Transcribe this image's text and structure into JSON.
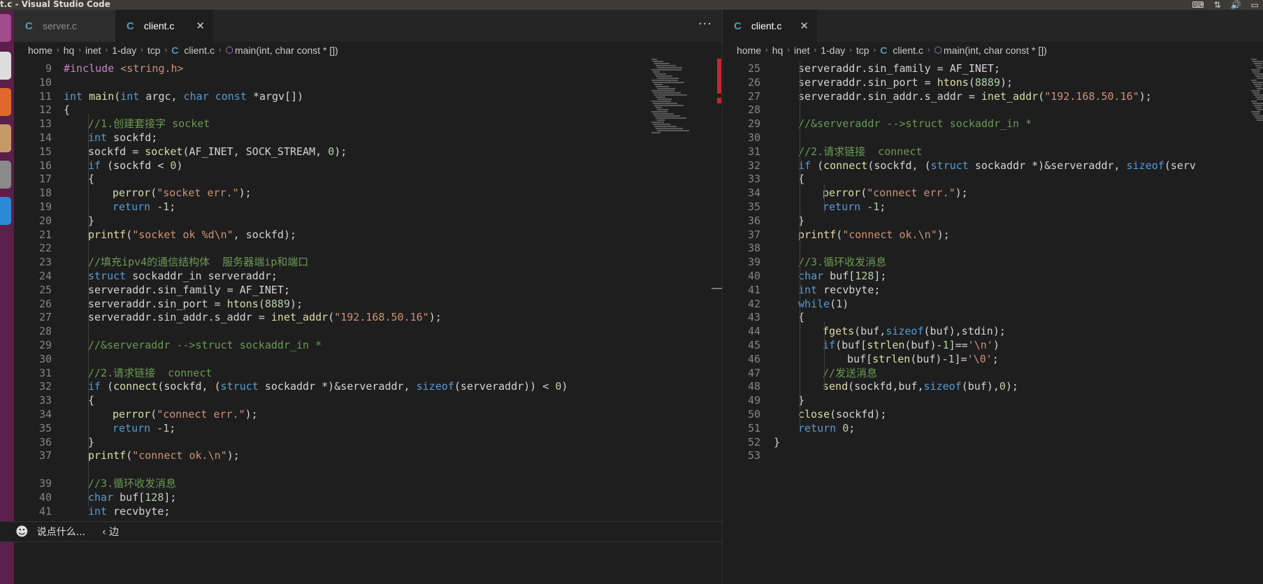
{
  "window": {
    "title": "t.c - Visual Studio Code"
  },
  "left_pane": {
    "tabs": [
      {
        "label": "server.c",
        "active": false
      },
      {
        "label": "client.c",
        "active": true
      }
    ],
    "more_actions": "···",
    "breadcrumb": [
      "home",
      "hq",
      "inet",
      "1-day",
      "tcp",
      "client.c",
      "main(int, char const * [])"
    ],
    "lines": [
      {
        "n": "9",
        "indent": 0,
        "tokens": [
          [
            "pp",
            "#include "
          ],
          [
            "str",
            "<string.h>"
          ]
        ]
      },
      {
        "n": "10",
        "indent": 0,
        "tokens": []
      },
      {
        "n": "11",
        "indent": 0,
        "tokens": [
          [
            "kw",
            "int "
          ],
          [
            "fn",
            "main"
          ],
          [
            "id",
            "("
          ],
          [
            "kw",
            "int "
          ],
          [
            "id",
            "argc, "
          ],
          [
            "kw",
            "char const "
          ],
          [
            "id",
            "*argv[])"
          ]
        ]
      },
      {
        "n": "12",
        "indent": 0,
        "tokens": [
          [
            "id",
            "{"
          ]
        ]
      },
      {
        "n": "13",
        "indent": 1,
        "tokens": [
          [
            "cm",
            "//1.创建套接字 socket"
          ]
        ]
      },
      {
        "n": "14",
        "indent": 1,
        "tokens": [
          [
            "kw",
            "int "
          ],
          [
            "id",
            "sockfd;"
          ]
        ]
      },
      {
        "n": "15",
        "indent": 1,
        "tokens": [
          [
            "id",
            "sockfd = "
          ],
          [
            "fn",
            "socket"
          ],
          [
            "id",
            "(AF_INET, SOCK_STREAM, "
          ],
          [
            "num",
            "0"
          ],
          [
            "id",
            ");"
          ]
        ]
      },
      {
        "n": "16",
        "indent": 1,
        "tokens": [
          [
            "kw",
            "if "
          ],
          [
            "id",
            "(sockfd < "
          ],
          [
            "num",
            "0"
          ],
          [
            "id",
            ")"
          ]
        ]
      },
      {
        "n": "17",
        "indent": 1,
        "tokens": [
          [
            "id",
            "{"
          ]
        ]
      },
      {
        "n": "18",
        "indent": 2,
        "tokens": [
          [
            "fn",
            "perror"
          ],
          [
            "id",
            "("
          ],
          [
            "str",
            "\"socket err.\""
          ],
          [
            "id",
            ");"
          ]
        ]
      },
      {
        "n": "19",
        "indent": 2,
        "tokens": [
          [
            "kw",
            "return "
          ],
          [
            "num",
            "-1"
          ],
          [
            "id",
            ";"
          ]
        ]
      },
      {
        "n": "20",
        "indent": 1,
        "tokens": [
          [
            "id",
            "}"
          ]
        ]
      },
      {
        "n": "21",
        "indent": 1,
        "tokens": [
          [
            "fn",
            "printf"
          ],
          [
            "id",
            "("
          ],
          [
            "str",
            "\"socket ok %d\\n\""
          ],
          [
            "id",
            ", sockfd);"
          ]
        ]
      },
      {
        "n": "22",
        "indent": 0,
        "tokens": []
      },
      {
        "n": "23",
        "indent": 1,
        "tokens": [
          [
            "cm",
            "//填充ipv4的通信结构体  服务器端ip和端口"
          ]
        ]
      },
      {
        "n": "24",
        "indent": 1,
        "tokens": [
          [
            "kw",
            "struct "
          ],
          [
            "id",
            "sockaddr_in serveraddr;"
          ]
        ]
      },
      {
        "n": "25",
        "indent": 1,
        "tokens": [
          [
            "id",
            "serveraddr.sin_family = AF_INET;"
          ]
        ]
      },
      {
        "n": "26",
        "indent": 1,
        "tokens": [
          [
            "id",
            "serveraddr.sin_port = "
          ],
          [
            "fn",
            "htons"
          ],
          [
            "id",
            "("
          ],
          [
            "num",
            "8889"
          ],
          [
            "id",
            ");"
          ]
        ]
      },
      {
        "n": "27",
        "indent": 1,
        "tokens": [
          [
            "id",
            "serveraddr.sin_addr.s_addr = "
          ],
          [
            "fn",
            "inet_addr"
          ],
          [
            "id",
            "("
          ],
          [
            "str",
            "\"192.168.50.16\""
          ],
          [
            "id",
            ");"
          ]
        ]
      },
      {
        "n": "28",
        "indent": 0,
        "tokens": []
      },
      {
        "n": "29",
        "indent": 1,
        "tokens": [
          [
            "cm",
            "//&serveraddr -->struct sockaddr_in *"
          ]
        ]
      },
      {
        "n": "30",
        "indent": 0,
        "tokens": []
      },
      {
        "n": "31",
        "indent": 1,
        "tokens": [
          [
            "cm",
            "//2.请求链接  connect"
          ]
        ]
      },
      {
        "n": "32",
        "indent": 1,
        "tokens": [
          [
            "kw",
            "if "
          ],
          [
            "id",
            "("
          ],
          [
            "fn",
            "connect"
          ],
          [
            "id",
            "(sockfd, ("
          ],
          [
            "kw",
            "struct "
          ],
          [
            "id",
            "sockaddr *)&serveraddr, "
          ],
          [
            "kw",
            "sizeof"
          ],
          [
            "id",
            "(serveraddr)) < "
          ],
          [
            "num",
            "0"
          ],
          [
            "id",
            ")"
          ]
        ]
      },
      {
        "n": "33",
        "indent": 1,
        "tokens": [
          [
            "id",
            "{"
          ]
        ]
      },
      {
        "n": "34",
        "indent": 2,
        "tokens": [
          [
            "fn",
            "perror"
          ],
          [
            "id",
            "("
          ],
          [
            "str",
            "\"connect err.\""
          ],
          [
            "id",
            ");"
          ]
        ]
      },
      {
        "n": "35",
        "indent": 2,
        "tokens": [
          [
            "kw",
            "return "
          ],
          [
            "num",
            "-1"
          ],
          [
            "id",
            ";"
          ]
        ]
      },
      {
        "n": "36",
        "indent": 1,
        "tokens": [
          [
            "id",
            "}"
          ]
        ]
      },
      {
        "n": "37",
        "indent": 1,
        "tokens": [
          [
            "fn",
            "printf"
          ],
          [
            "id",
            "("
          ],
          [
            "str",
            "\"connect ok.\\n\""
          ],
          [
            "id",
            ");"
          ]
        ]
      },
      {
        "n": "39",
        "indent": 1,
        "tokens": [
          [
            "cm",
            "//3.循环收发消息"
          ]
        ]
      },
      {
        "n": "40",
        "indent": 1,
        "tokens": [
          [
            "kw",
            "char "
          ],
          [
            "id",
            "buf["
          ],
          [
            "num",
            "128"
          ],
          [
            "id",
            "];"
          ]
        ]
      },
      {
        "n": "41",
        "indent": 1,
        "tokens": [
          [
            "kw",
            "int "
          ],
          [
            "id",
            "recvbyte;"
          ]
        ]
      }
    ]
  },
  "right_pane": {
    "tabs": [
      {
        "label": "client.c",
        "active": true
      }
    ],
    "breadcrumb": [
      "home",
      "hq",
      "inet",
      "1-day",
      "tcp",
      "client.c",
      "main(int, char const * [])"
    ],
    "lines": [
      {
        "n": "25",
        "indent": 1,
        "tokens": [
          [
            "id",
            "serveraddr.sin_family = AF_INET;"
          ]
        ]
      },
      {
        "n": "26",
        "indent": 1,
        "tokens": [
          [
            "id",
            "serveraddr.sin_port = "
          ],
          [
            "fn",
            "htons"
          ],
          [
            "id",
            "("
          ],
          [
            "num",
            "8889"
          ],
          [
            "id",
            ");"
          ]
        ]
      },
      {
        "n": "27",
        "indent": 1,
        "tokens": [
          [
            "id",
            "serveraddr.sin_addr.s_addr = "
          ],
          [
            "fn",
            "inet_addr"
          ],
          [
            "id",
            "("
          ],
          [
            "str",
            "\"192.168.50.16\""
          ],
          [
            "id",
            ");"
          ]
        ]
      },
      {
        "n": "28",
        "indent": 0,
        "tokens": []
      },
      {
        "n": "29",
        "indent": 1,
        "tokens": [
          [
            "cm",
            "//&serveraddr -->struct sockaddr_in *"
          ]
        ]
      },
      {
        "n": "30",
        "indent": 0,
        "tokens": []
      },
      {
        "n": "31",
        "indent": 1,
        "tokens": [
          [
            "cm",
            "//2.请求链接  connect"
          ]
        ]
      },
      {
        "n": "32",
        "indent": 1,
        "tokens": [
          [
            "kw",
            "if "
          ],
          [
            "id",
            "("
          ],
          [
            "fn",
            "connect"
          ],
          [
            "id",
            "(sockfd, ("
          ],
          [
            "kw",
            "struct "
          ],
          [
            "id",
            "sockaddr *)&serveraddr, "
          ],
          [
            "kw",
            "sizeof"
          ],
          [
            "id",
            "(serv"
          ]
        ]
      },
      {
        "n": "33",
        "indent": 1,
        "tokens": [
          [
            "id",
            "{"
          ]
        ]
      },
      {
        "n": "34",
        "indent": 2,
        "tokens": [
          [
            "fn",
            "perror"
          ],
          [
            "id",
            "("
          ],
          [
            "str",
            "\"connect err.\""
          ],
          [
            "id",
            ");"
          ]
        ]
      },
      {
        "n": "35",
        "indent": 2,
        "tokens": [
          [
            "kw",
            "return "
          ],
          [
            "num",
            "-1"
          ],
          [
            "id",
            ";"
          ]
        ]
      },
      {
        "n": "36",
        "indent": 1,
        "tokens": [
          [
            "id",
            "}"
          ]
        ]
      },
      {
        "n": "37",
        "indent": 1,
        "tokens": [
          [
            "fn",
            "printf"
          ],
          [
            "id",
            "("
          ],
          [
            "str",
            "\"connect ok.\\n\""
          ],
          [
            "id",
            ");"
          ]
        ]
      },
      {
        "n": "38",
        "indent": 0,
        "tokens": []
      },
      {
        "n": "39",
        "indent": 1,
        "tokens": [
          [
            "cm",
            "//3.循环收发消息"
          ]
        ]
      },
      {
        "n": "40",
        "indent": 1,
        "tokens": [
          [
            "kw",
            "char "
          ],
          [
            "id",
            "buf["
          ],
          [
            "num",
            "128"
          ],
          [
            "id",
            "];"
          ]
        ]
      },
      {
        "n": "41",
        "indent": 1,
        "tokens": [
          [
            "kw",
            "int "
          ],
          [
            "id",
            "recvbyte;"
          ]
        ]
      },
      {
        "n": "42",
        "indent": 1,
        "tokens": [
          [
            "kw",
            "while"
          ],
          [
            "id",
            "("
          ],
          [
            "num",
            "1"
          ],
          [
            "id",
            ")"
          ]
        ]
      },
      {
        "n": "43",
        "indent": 1,
        "tokens": [
          [
            "id",
            "{"
          ]
        ]
      },
      {
        "n": "44",
        "indent": 2,
        "tokens": [
          [
            "fn",
            "fgets"
          ],
          [
            "id",
            "(buf,"
          ],
          [
            "kw",
            "sizeof"
          ],
          [
            "id",
            "(buf),stdin);"
          ]
        ]
      },
      {
        "n": "45",
        "indent": 2,
        "tokens": [
          [
            "kw",
            "if"
          ],
          [
            "id",
            "(buf["
          ],
          [
            "fn",
            "strlen"
          ],
          [
            "id",
            "(buf)-"
          ],
          [
            "num",
            "1"
          ],
          [
            "id",
            "]=="
          ],
          [
            "str",
            "'\\n'"
          ],
          [
            "id",
            ")"
          ]
        ]
      },
      {
        "n": "46",
        "indent": 3,
        "tokens": [
          [
            "id",
            "buf["
          ],
          [
            "fn",
            "strlen"
          ],
          [
            "id",
            "(buf)-"
          ],
          [
            "num",
            "1"
          ],
          [
            "id",
            "]="
          ],
          [
            "str",
            "'\\0'"
          ],
          [
            "id",
            ";"
          ]
        ]
      },
      {
        "n": "47",
        "indent": 2,
        "tokens": [
          [
            "cm",
            "//发送消息"
          ]
        ]
      },
      {
        "n": "48",
        "indent": 2,
        "tokens": [
          [
            "fn",
            "send"
          ],
          [
            "id",
            "(sockfd,buf,"
          ],
          [
            "kw",
            "sizeof"
          ],
          [
            "id",
            "(buf),"
          ],
          [
            "num",
            "0"
          ],
          [
            "id",
            ");"
          ]
        ]
      },
      {
        "n": "49",
        "indent": 1,
        "tokens": [
          [
            "id",
            "}"
          ]
        ]
      },
      {
        "n": "50",
        "indent": 1,
        "tokens": [
          [
            "fn",
            "close"
          ],
          [
            "id",
            "(sockfd);"
          ]
        ]
      },
      {
        "n": "51",
        "indent": 1,
        "tokens": [
          [
            "kw",
            "return "
          ],
          [
            "num",
            "0"
          ],
          [
            "id",
            ";"
          ]
        ]
      },
      {
        "n": "52",
        "indent": 0,
        "tokens": [
          [
            "id",
            "}"
          ]
        ]
      },
      {
        "n": "53",
        "indent": 0,
        "tokens": []
      }
    ]
  },
  "chat_bar": {
    "placeholder": "说点什么...",
    "back_label": "‹ 边"
  },
  "colors": {
    "keyword": "#569cd6",
    "function": "#dcdcaa",
    "string": "#ce9178",
    "number": "#b5cea8",
    "comment": "#6a9955",
    "preprocessor": "#c586c0"
  }
}
